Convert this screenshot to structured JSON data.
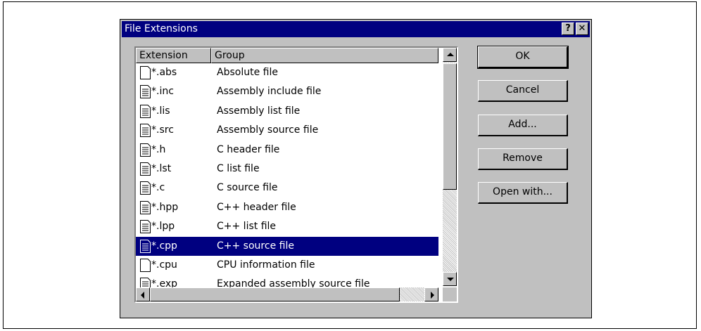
{
  "dialog": {
    "title": "File Extensions",
    "help_label": "?",
    "close_label": "✕"
  },
  "list": {
    "columns": [
      "Extension",
      "Group"
    ],
    "rows": [
      {
        "ext": "*.abs",
        "group": "Absolute file",
        "icon": "blank-document-icon"
      },
      {
        "ext": "*.inc",
        "group": "Assembly include file",
        "icon": "text-document-icon"
      },
      {
        "ext": "*.lis",
        "group": "Assembly list file",
        "icon": "text-document-icon"
      },
      {
        "ext": "*.src",
        "group": "Assembly source file",
        "icon": "text-document-icon"
      },
      {
        "ext": "*.h",
        "group": "C header file",
        "icon": "text-document-icon"
      },
      {
        "ext": "*.lst",
        "group": "C list file",
        "icon": "text-document-icon"
      },
      {
        "ext": "*.c",
        "group": "C source file",
        "icon": "text-document-icon"
      },
      {
        "ext": "*.hpp",
        "group": "C++ header file",
        "icon": "text-document-icon"
      },
      {
        "ext": "*.lpp",
        "group": "C++ list file",
        "icon": "text-document-icon"
      },
      {
        "ext": "*.cpp",
        "group": "C++ source file",
        "icon": "text-document-icon",
        "selected": true
      },
      {
        "ext": "*.cpu",
        "group": "CPU information file",
        "icon": "blank-document-icon"
      },
      {
        "ext": "*.exp",
        "group": "Expanded assembly source file",
        "icon": "text-document-icon"
      }
    ]
  },
  "buttons": {
    "ok": "OK",
    "cancel": "Cancel",
    "add": "Add...",
    "remove": "Remove",
    "open_with": "Open with..."
  },
  "colors": {
    "titlebar": "#000080",
    "dialog_face": "#c0c0c0",
    "selection": "#000080"
  }
}
